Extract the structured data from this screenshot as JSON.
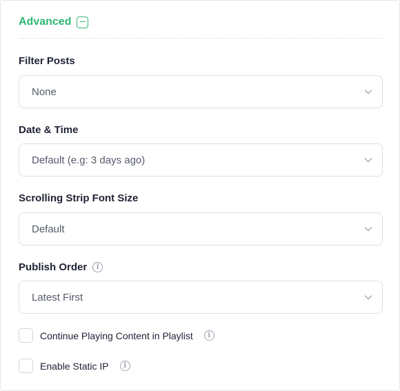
{
  "section": {
    "title": "Advanced",
    "collapse_icon": "minus-square-icon",
    "accent_color": "#2eb872"
  },
  "fields": {
    "filter_posts": {
      "label": "Filter Posts",
      "value": "None"
    },
    "date_time": {
      "label": "Date & Time",
      "value": "Default (e.g: 3 days ago)"
    },
    "scrolling_strip_font_size": {
      "label": "Scrolling Strip Font Size",
      "value": "Default"
    },
    "publish_order": {
      "label": "Publish Order",
      "value": "Latest First",
      "info_icon": "info-icon"
    }
  },
  "checkboxes": {
    "continue_playing": {
      "label": "Continue Playing Content in Playlist",
      "checked": false
    },
    "enable_static_ip": {
      "label": "Enable Static IP",
      "checked": false
    }
  },
  "info_glyph": "i"
}
